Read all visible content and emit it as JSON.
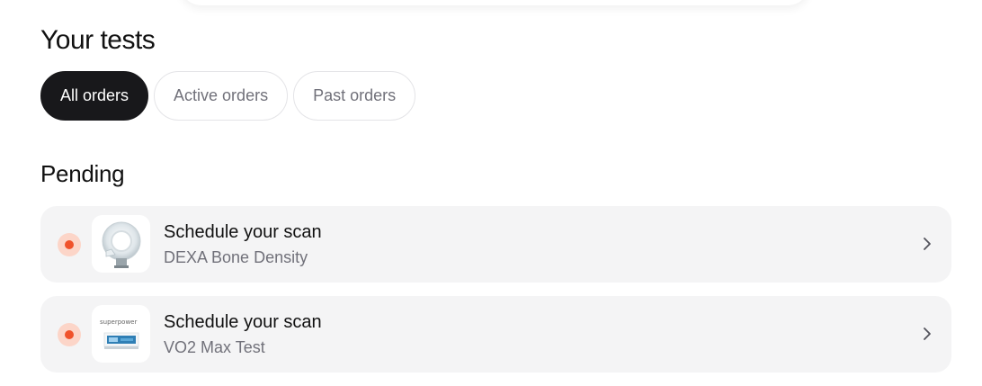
{
  "page": {
    "title": "Your tests"
  },
  "tabs": [
    {
      "label": "All orders",
      "active": true
    },
    {
      "label": "Active orders",
      "active": false
    },
    {
      "label": "Past orders",
      "active": false
    }
  ],
  "section": {
    "title": "Pending"
  },
  "orders": [
    {
      "title": "Schedule your scan",
      "subtitle": "DEXA Bone Density",
      "status_color": "#f0522b",
      "thumbnail_icon": "dexa-scanner-image",
      "action_icon": "chevron-right-icon"
    },
    {
      "title": "Schedule your scan",
      "subtitle": "VO2 Max Test",
      "status_color": "#f0522b",
      "thumbnail_icon": "vo2-max-image",
      "brand_text": "superpower",
      "action_icon": "chevron-right-icon"
    }
  ],
  "colors": {
    "active_tab_bg": "#18181b",
    "card_bg": "#f4f4f5",
    "status_dot": "#f0522b",
    "status_halo": "#fcd5c8",
    "muted_text": "#71717a"
  }
}
